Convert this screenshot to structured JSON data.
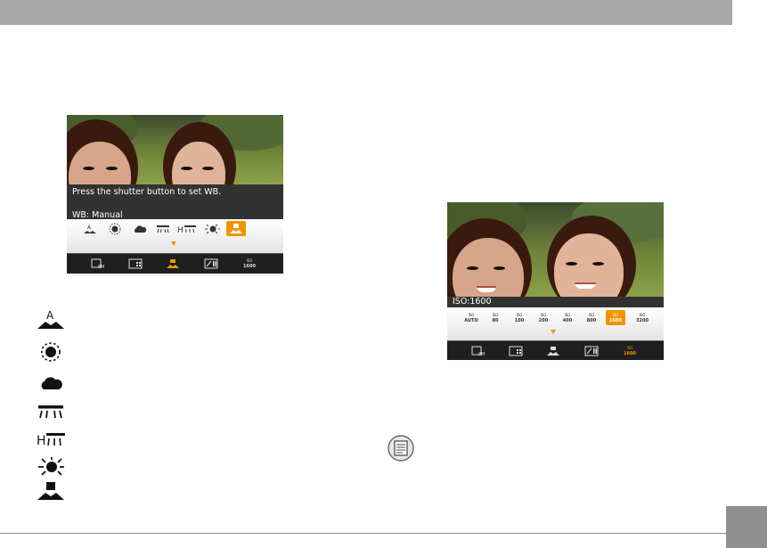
{
  "page": {
    "header_band_color": "#a8a8a8",
    "accent_color": "#f29400"
  },
  "wb_screen": {
    "instruction": "Press the shutter button to set WB.",
    "current_setting": "WB: Manual",
    "options": [
      {
        "icon": "auto-wb-icon"
      },
      {
        "icon": "daylight-icon"
      },
      {
        "icon": "cloudy-icon"
      },
      {
        "icon": "fluorescent-icon"
      },
      {
        "icon": "fluorescent-h-icon"
      },
      {
        "icon": "incandescent-icon"
      },
      {
        "icon": "manual-wb-icon",
        "selected": true
      }
    ],
    "menu": [
      {
        "icon": "image-size-icon",
        "text": "8M"
      },
      {
        "icon": "quality-icon"
      },
      {
        "icon": "white-balance-icon",
        "active": true
      },
      {
        "icon": "exposure-icon"
      },
      {
        "icon": "iso-icon",
        "top": "ISO",
        "value": "1600"
      }
    ]
  },
  "iso_screen": {
    "current_setting": "ISO:1600",
    "options": [
      {
        "top": "ISO",
        "value": "AUTO"
      },
      {
        "top": "ISO",
        "value": "80"
      },
      {
        "top": "ISO",
        "value": "100"
      },
      {
        "top": "ISO",
        "value": "200"
      },
      {
        "top": "ISO",
        "value": "400"
      },
      {
        "top": "ISO",
        "value": "800"
      },
      {
        "top": "ISO",
        "value": "1600",
        "selected": true
      },
      {
        "top": "ISO",
        "value": "3200"
      }
    ],
    "menu": [
      {
        "icon": "image-size-icon",
        "text": "8M"
      },
      {
        "icon": "quality-icon"
      },
      {
        "icon": "white-balance-icon"
      },
      {
        "icon": "exposure-icon"
      },
      {
        "icon": "iso-icon",
        "top": "ISO",
        "value": "1600",
        "active": true
      }
    ]
  },
  "legend": [
    {
      "icon": "auto-wb-icon"
    },
    {
      "icon": "daylight-icon"
    },
    {
      "icon": "cloudy-icon"
    },
    {
      "icon": "fluorescent-icon"
    },
    {
      "icon": "fluorescent-h-icon"
    },
    {
      "icon": "incandescent-icon"
    },
    {
      "icon": "manual-wb-icon"
    }
  ],
  "note": {
    "icon": "note-icon"
  }
}
